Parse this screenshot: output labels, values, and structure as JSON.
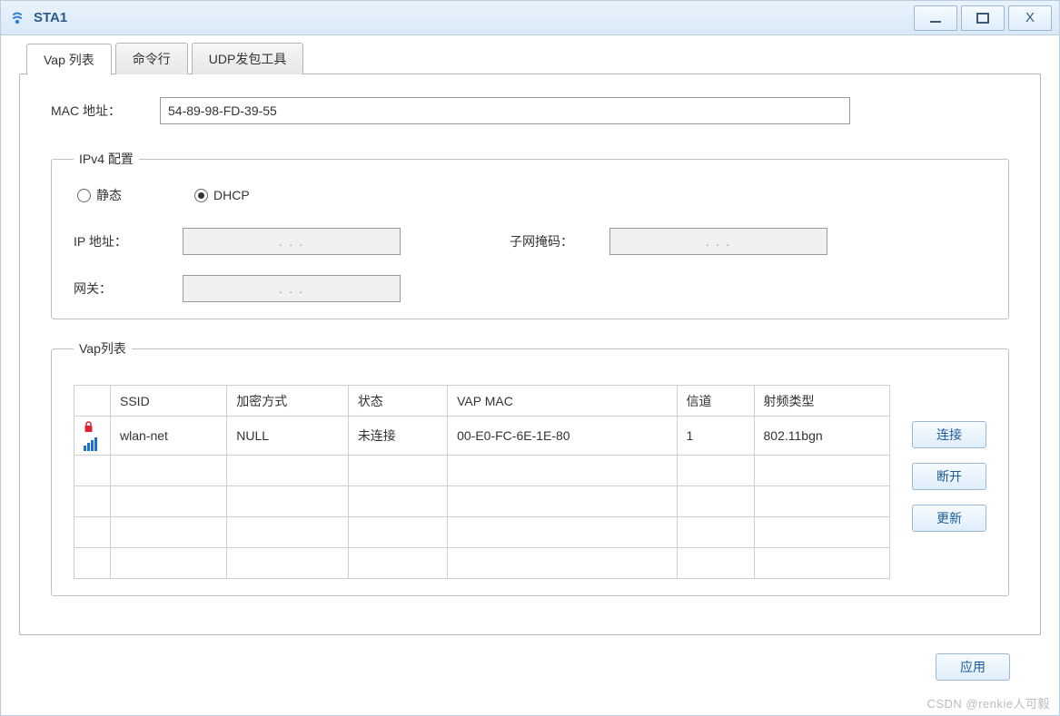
{
  "window": {
    "title": "STA1"
  },
  "tabs": {
    "vap_list": "Vap 列表",
    "cli": "命令行",
    "udp_tool": "UDP发包工具"
  },
  "mac": {
    "label": "MAC 地址：",
    "value": "54-89-98-FD-39-55"
  },
  "ipv4": {
    "legend": "IPv4 配置",
    "static_label": "静态",
    "dhcp_label": "DHCP",
    "mode": "dhcp",
    "ip_label": "IP 地址：",
    "mask_label": "子网掩码：",
    "gateway_label": "网关：",
    "ip_value": ".       .       .",
    "mask_value": ".       .       .",
    "gateway_value": ".       .       ."
  },
  "vap": {
    "legend": "Vap列表",
    "headers": {
      "ssid": "SSID",
      "encrypt": "加密方式",
      "status": "状态",
      "vap_mac": "VAP MAC",
      "channel": "信道",
      "radio": "射频类型"
    },
    "rows": [
      {
        "locked": true,
        "signal": 4,
        "ssid": "wlan-net",
        "encrypt": "NULL",
        "status": "未连接",
        "vap_mac": "00-E0-FC-6E-1E-80",
        "channel": "1",
        "radio": "802.11bgn"
      },
      {
        "locked": false,
        "signal": 0,
        "ssid": "",
        "encrypt": "",
        "status": "",
        "vap_mac": "",
        "channel": "",
        "radio": ""
      },
      {
        "locked": false,
        "signal": 0,
        "ssid": "",
        "encrypt": "",
        "status": "",
        "vap_mac": "",
        "channel": "",
        "radio": ""
      },
      {
        "locked": false,
        "signal": 0,
        "ssid": "",
        "encrypt": "",
        "status": "",
        "vap_mac": "",
        "channel": "",
        "radio": ""
      },
      {
        "locked": false,
        "signal": 0,
        "ssid": "",
        "encrypt": "",
        "status": "",
        "vap_mac": "",
        "channel": "",
        "radio": ""
      }
    ],
    "buttons": {
      "connect": "连接",
      "disconnect": "断开",
      "refresh": "更新"
    }
  },
  "apply_label": "应用",
  "watermark": "CSDN @renkie人可毅"
}
